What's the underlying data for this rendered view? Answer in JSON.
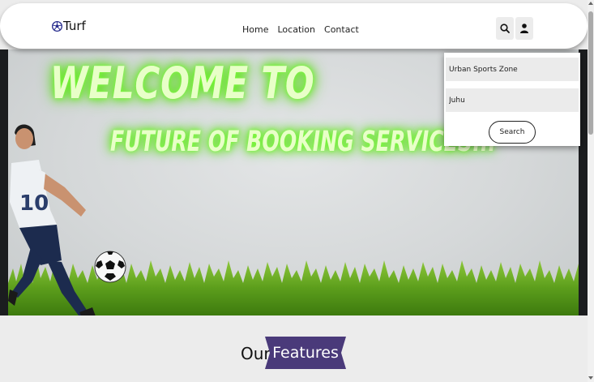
{
  "header": {
    "logo_text": "Turf",
    "logo_icon": "soccer-ball-icon",
    "nav": [
      {
        "label": "Home"
      },
      {
        "label": "Location"
      },
      {
        "label": "Contact"
      }
    ],
    "search_icon": "search-icon",
    "user_icon": "user-icon"
  },
  "hero": {
    "title": "WELCOME  TO",
    "subtitle": "FUTURE OF BOOKING SERVICES...",
    "glow_color": "#7cff3a"
  },
  "search_dropdown": {
    "turf_value": "Urban Sports Zone",
    "location_value": "Juhu",
    "search_label": "Search"
  },
  "features": {
    "prefix": "Our",
    "highlight": "Features",
    "highlight_color": "#4a3a7a"
  }
}
